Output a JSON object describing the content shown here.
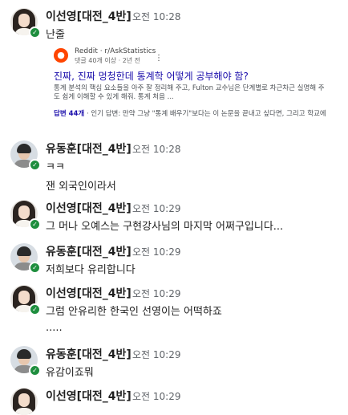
{
  "messages": [
    {
      "author": "이선영[대전_4반]",
      "time": "오전 10:28",
      "avatar": "female-avatar",
      "lines": [
        "난줄"
      ],
      "link_card": {
        "source": "Reddit · r/AskStatistics",
        "meta": "댓글 40개 이상 · 2년 전",
        "title": "진짜, 진짜 멍청한데 통계학 어떻게 공부해야 함?",
        "description_1": "통계 분석의 핵심 요소들을 아주 잘 정리해 주고, Fulton 교수님은 단계별로 차근차근 실명해 주",
        "description_2": "도 쉽게 이해할 수 있게 해줘. 통계 처음 ...",
        "answers_link": "답변 44개",
        "answers_text": " · 인기 답변: 만약 그냥 \"통계 배우기\"보다는 이 논문을 끝내고 싶다면, 그리고 학교에"
      }
    },
    {
      "author": "유동훈[대전_4반]",
      "time": "오전 10:28",
      "avatar": "male-avatar",
      "lines": [
        "ㅋㅋ",
        "잰 외국인이라서"
      ]
    },
    {
      "author": "이선영[대전_4반]",
      "time": "오전 10:29",
      "avatar": "female-avatar",
      "lines": [
        "그 머나 오예스는 구현강사님의 마지막 어쩌구입니다..."
      ]
    },
    {
      "author": "유동훈[대전_4반]",
      "time": "오전 10:29",
      "avatar": "male-avatar",
      "lines": [
        "저희보다 유리합니다"
      ]
    },
    {
      "author": "이선영[대전_4반]",
      "time": "오전 10:29",
      "avatar": "female-avatar",
      "lines": [
        "그럼 안유리한 한국인 선영이는 어떡하죠",
        "....."
      ]
    },
    {
      "author": "유동훈[대전_4반]",
      "time": "오전 10:29",
      "avatar": "male-avatar",
      "lines": [
        "유감이죠뭐"
      ]
    },
    {
      "author": "이선영[대전_4반]",
      "time": "오전 10:29",
      "avatar": "female-avatar",
      "lines": []
    }
  ],
  "status_color": "#1e8e3e",
  "reddit_color": "#ff4500",
  "link_color": "#1a0dab"
}
